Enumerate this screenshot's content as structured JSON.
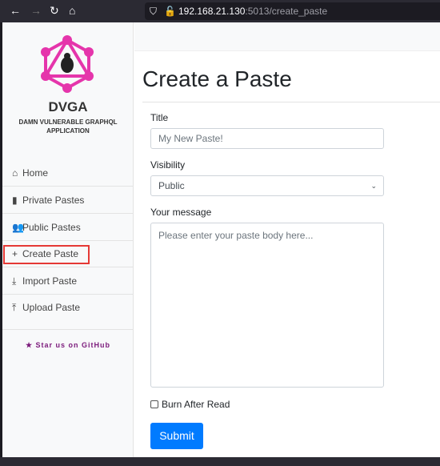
{
  "browser": {
    "url_host": "192.168.21.130",
    "url_path": ":5013/create_paste"
  },
  "sidebar": {
    "brand": "DVGA",
    "subtitle_1": "DAMN VULNERABLE GRAPHQL",
    "subtitle_2": "APPLICATION",
    "items": [
      {
        "label": "Home",
        "icon": "home-icon"
      },
      {
        "label": "Private Pastes",
        "icon": "clipboard-icon"
      },
      {
        "label": "Public Pastes",
        "icon": "users-icon"
      },
      {
        "label": "Create Paste",
        "icon": "plus-icon"
      },
      {
        "label": "Import Paste",
        "icon": "download-icon"
      },
      {
        "label": "Upload Paste",
        "icon": "upload-icon"
      }
    ],
    "github": "Star us on GitHub"
  },
  "main": {
    "title": "Create a Paste",
    "title_label": "Title",
    "title_placeholder": "My New Paste!",
    "visibility_label": "Visibility",
    "visibility_value": "Public",
    "message_label": "Your message",
    "message_placeholder": "Please enter your paste body here...",
    "burn_label": "Burn After Read",
    "submit": "Submit"
  },
  "colors": {
    "accent": "#007bff",
    "logo": "#e535ab",
    "highlight": "#e53935"
  }
}
